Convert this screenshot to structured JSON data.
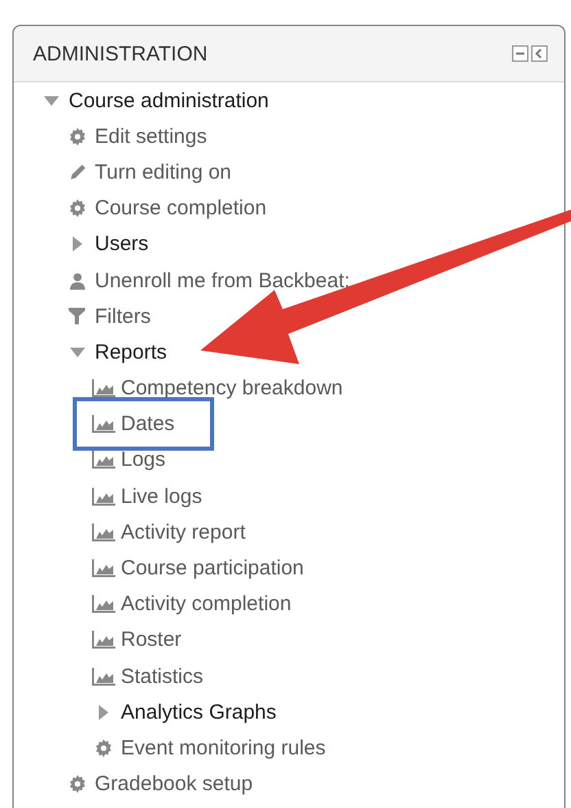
{
  "block": {
    "title": "ADMINISTRATION"
  },
  "tree": [
    {
      "kind": "branch",
      "label": "Course administration",
      "expanded": true,
      "children": [
        {
          "kind": "setting",
          "label": "Edit settings"
        },
        {
          "kind": "edit",
          "label": "Turn editing on"
        },
        {
          "kind": "setting",
          "label": "Course completion"
        },
        {
          "kind": "branch",
          "label": "Users",
          "expanded": false
        },
        {
          "kind": "user",
          "label": "Unenroll me from Backbeat;"
        },
        {
          "kind": "filter",
          "label": "Filters"
        },
        {
          "kind": "branch",
          "label": "Reports",
          "expanded": true,
          "pointed": true,
          "children": [
            {
              "kind": "report",
              "label": "Competency breakdown",
              "highlighted": false
            },
            {
              "kind": "report",
              "label": "Dates",
              "highlighted": true
            },
            {
              "kind": "report",
              "label": "Logs",
              "highlighted": false
            },
            {
              "kind": "report",
              "label": "Live logs",
              "highlighted": false
            },
            {
              "kind": "report",
              "label": "Activity report",
              "highlighted": false
            },
            {
              "kind": "report",
              "label": "Course participation",
              "highlighted": false
            },
            {
              "kind": "report",
              "label": "Activity completion",
              "highlighted": false
            },
            {
              "kind": "report",
              "label": "Roster",
              "highlighted": false
            },
            {
              "kind": "report",
              "label": "Statistics",
              "highlighted": false
            },
            {
              "kind": "branch",
              "label": "Analytics Graphs",
              "expanded": false
            },
            {
              "kind": "setting",
              "label": "Event monitoring rules"
            }
          ]
        },
        {
          "kind": "setting",
          "label": "Gradebook setup"
        }
      ]
    }
  ]
}
